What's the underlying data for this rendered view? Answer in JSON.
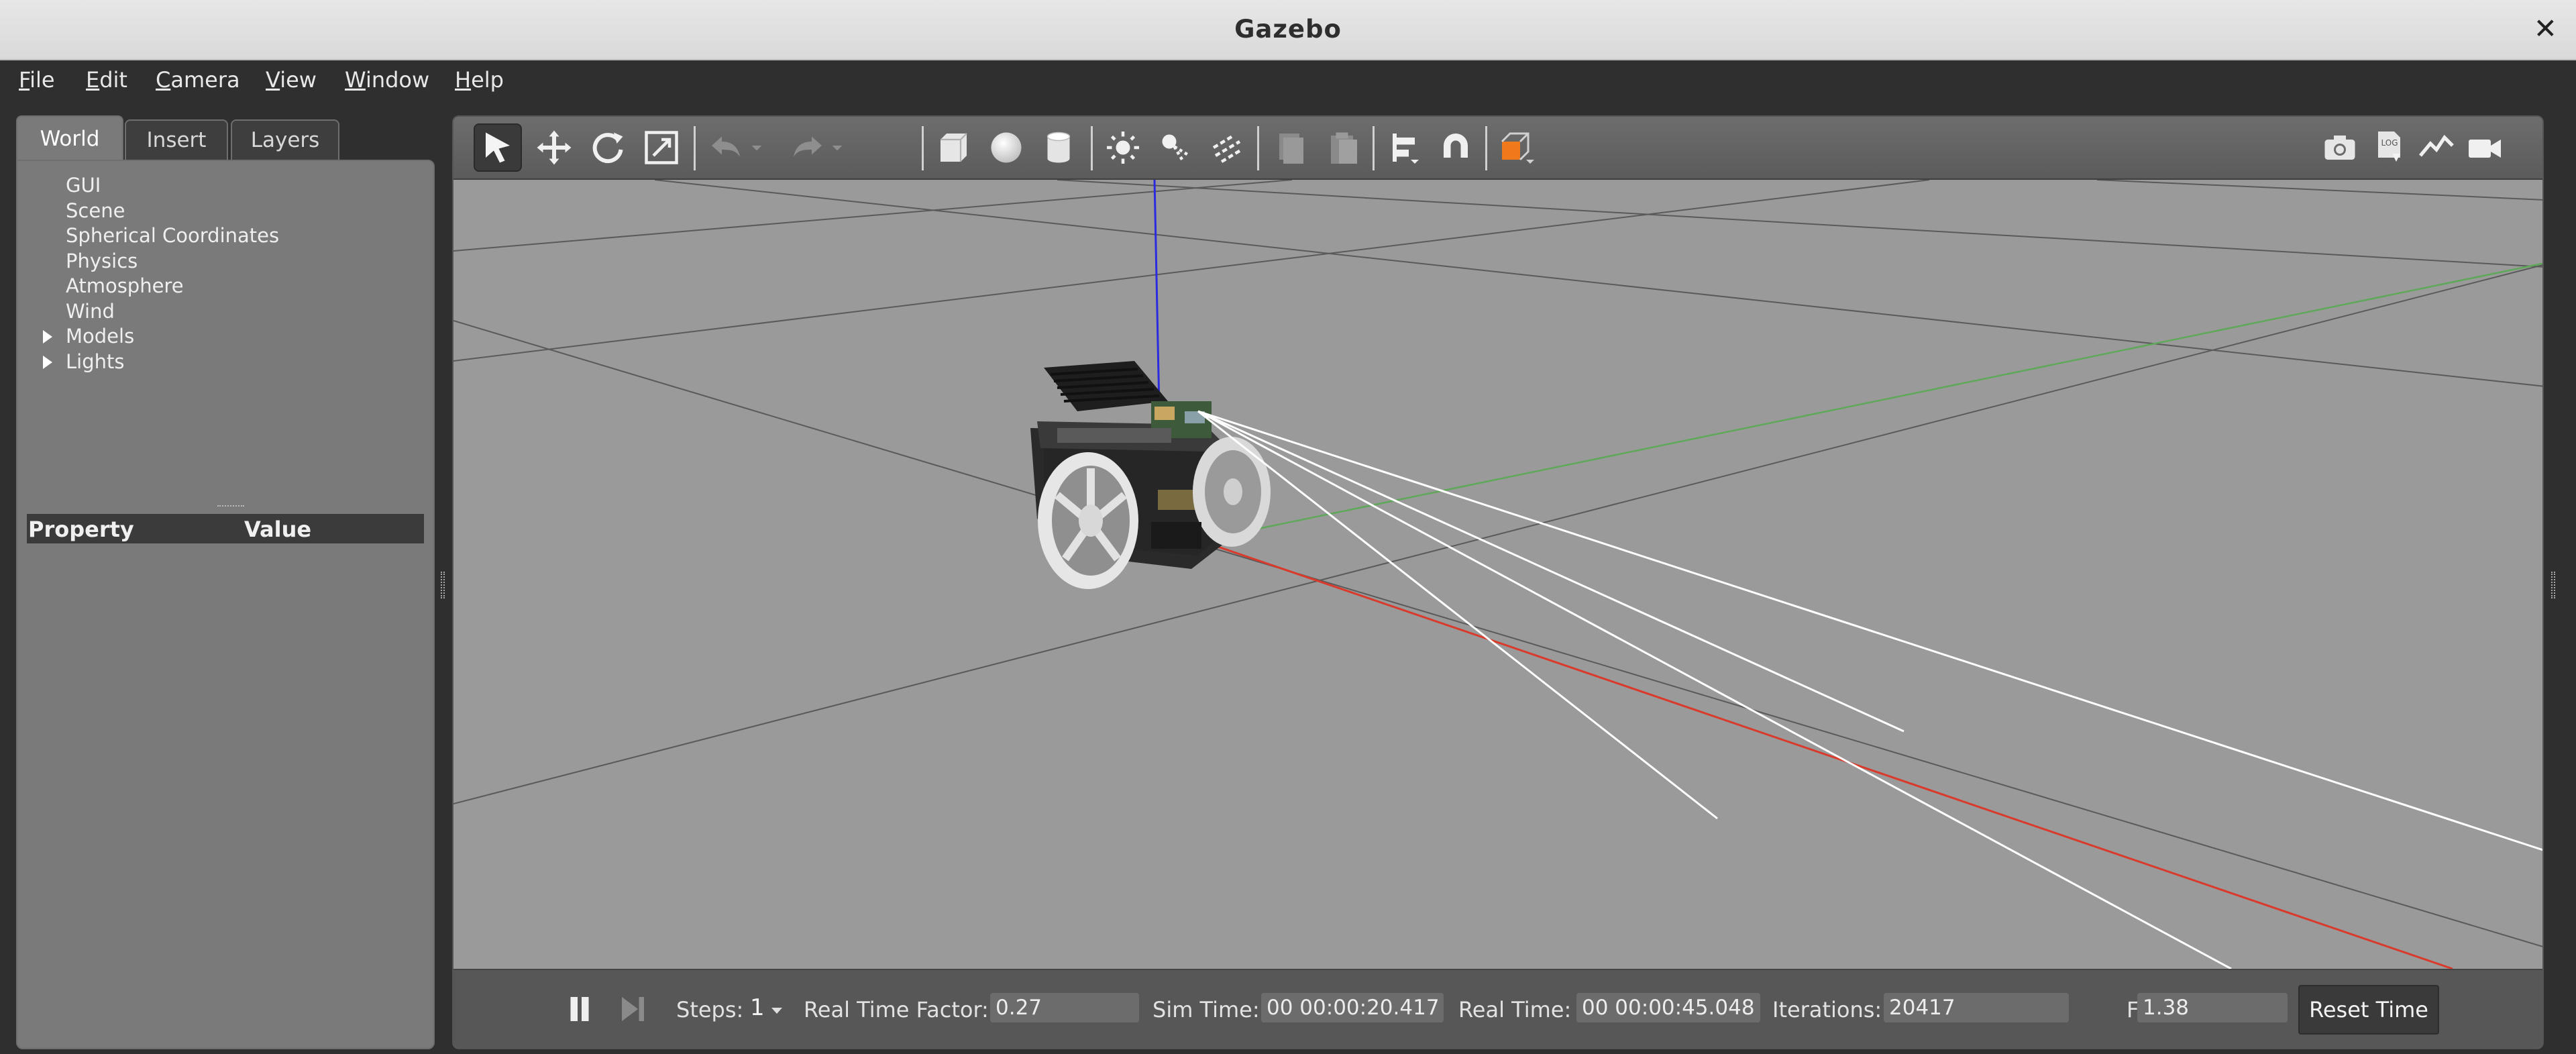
{
  "window": {
    "title": "Gazebo",
    "close_glyph": "✕"
  },
  "menu": [
    {
      "label": "File",
      "accel": "F",
      "rest": "ile"
    },
    {
      "label": "Edit",
      "accel": "E",
      "rest": "dit"
    },
    {
      "label": "Camera",
      "accel": "C",
      "rest": "amera"
    },
    {
      "label": "View",
      "accel": "V",
      "rest": "iew"
    },
    {
      "label": "Window",
      "accel": "W",
      "rest": "indow"
    },
    {
      "label": "Help",
      "accel": "H",
      "rest": "elp"
    }
  ],
  "left_panel": {
    "tabs": [
      "World",
      "Insert",
      "Layers"
    ],
    "active_tab": "World",
    "tree": [
      "GUI",
      "Scene",
      "Spherical Coordinates",
      "Physics",
      "Atmosphere",
      "Wind",
      "Models",
      "Lights"
    ],
    "expandable": [
      "Models",
      "Lights"
    ],
    "property_header": {
      "property": "Property",
      "value": "Value"
    }
  },
  "toolbar": {
    "left_icons": [
      "select-arrow-icon",
      "translate-icon",
      "rotate-icon",
      "scale-icon",
      "undo-icon",
      "redo-icon",
      "box-icon",
      "sphere-icon",
      "cylinder-icon",
      "point-light-icon",
      "spot-light-icon",
      "directional-light-icon",
      "copy-icon",
      "paste-icon",
      "align-icon",
      "snap-magnet-icon",
      "view-angle-icon"
    ],
    "right_icons": [
      "screenshot-camera-icon",
      "log-icon",
      "plot-icon",
      "video-record-icon"
    ]
  },
  "status": {
    "steps_label": "Steps:",
    "steps_value": "1",
    "rtf_label": "Real Time Factor:",
    "rtf_value": "0.27",
    "sim_time_label": "Sim Time:",
    "sim_time_value": "00 00:00:20.417",
    "real_time_label": "Real Time:",
    "real_time_value": "00 00:00:45.048",
    "iterations_label": "Iterations:",
    "iterations_value": "20417",
    "fps_label": "FPS:",
    "fps_value": "1.38",
    "reset_label": "Reset Time"
  },
  "colors": {
    "background": "#9a9a9a",
    "x_axis": "#d93a2b",
    "y_axis": "#5fa85a",
    "z_axis": "#2a2ae0",
    "sensor_rays": "#ffffff",
    "view_angle_accent": "#f07a1a"
  }
}
